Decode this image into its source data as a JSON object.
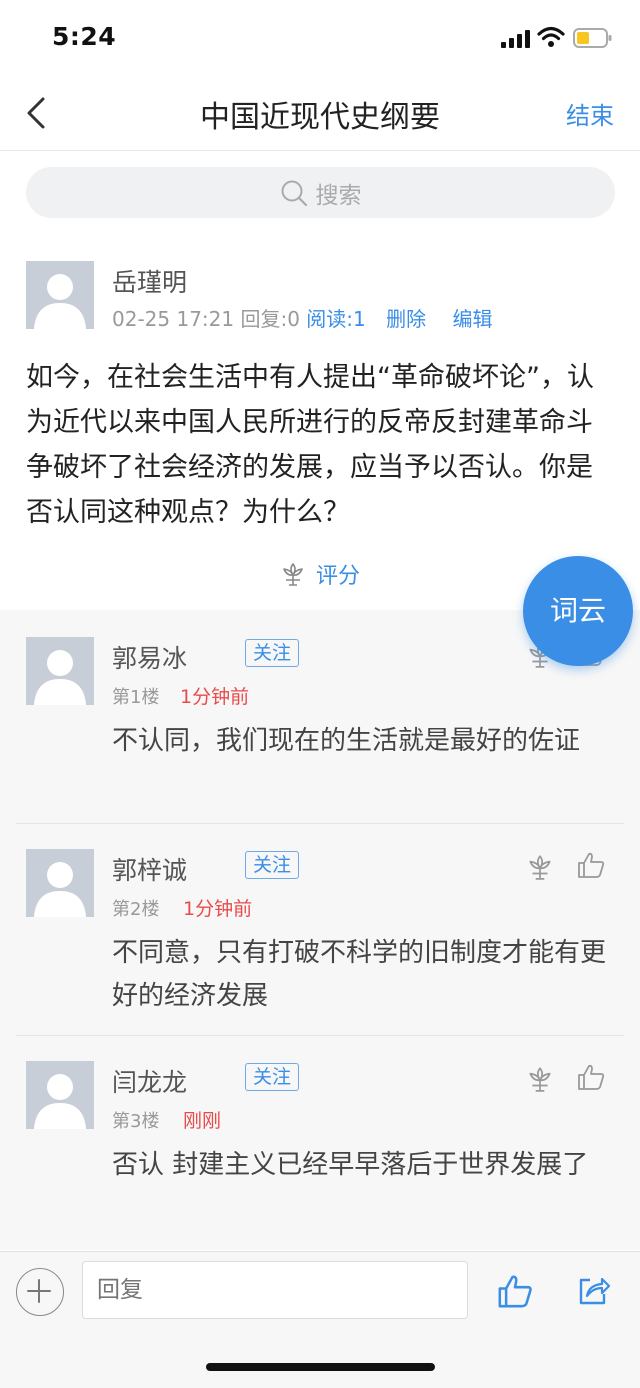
{
  "status": {
    "time": "5:24"
  },
  "nav": {
    "title": "中国近现代史纲要",
    "end_label": "结束"
  },
  "search": {
    "placeholder": "搜索"
  },
  "post": {
    "author": "岳瑾明",
    "date": "02-25 17:21",
    "replies": "回复:0",
    "reads": "阅读:1",
    "delete_label": "删除",
    "edit_label": "编辑",
    "content": "如今，在社会生活中有人提出“革命破坏论”，认为近代以来中国人民所进行的反帝反封建革命斗争破坏了社会经济的发展，应当予以否认。你是否认同这种观点？为什么？",
    "rate_label": "评分"
  },
  "fab_label": "词云",
  "comments": [
    {
      "name": "郭易冰",
      "follow": "关注",
      "floor": "第1楼",
      "time": "1分钟前",
      "text": "不认同，我们现在的生活就是最好的佐证"
    },
    {
      "name": "郭梓诚",
      "follow": "关注",
      "floor": "第2楼",
      "time": "1分钟前",
      "text": "不同意，只有打破不科学的旧制度才能有更好的经济发展"
    },
    {
      "name": "闫龙龙",
      "follow": "关注",
      "floor": "第3楼",
      "time": "刚刚",
      "text": "否认 封建主义已经早早落后于世界发展了"
    }
  ],
  "reply": {
    "placeholder": "回复"
  },
  "colors": {
    "accent": "#3a8ee6",
    "time_red": "#e94b4b"
  }
}
